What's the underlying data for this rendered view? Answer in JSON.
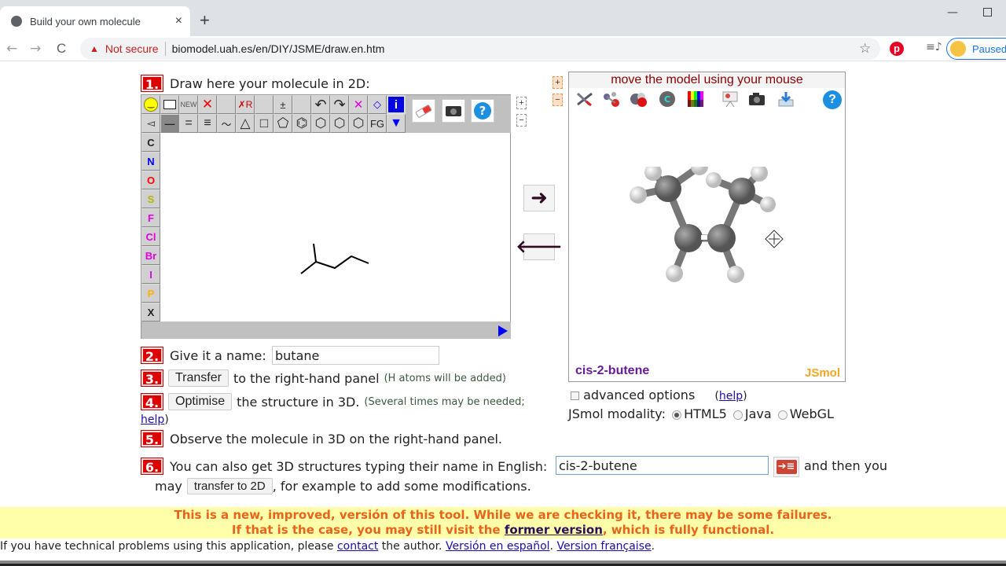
{
  "browser": {
    "tab_title": "Build your own molecule",
    "tab_close": "×",
    "new_tab": "+",
    "back": "←",
    "forward": "→",
    "reload": "C",
    "security_warning": "Not secure",
    "url": "biomodel.uah.es/en/DIY/JSME/draw.en.htm",
    "star": "☆",
    "pinterest": "p",
    "media": "≡♪",
    "profile_label": "Paused",
    "minimize": "—"
  },
  "steps": {
    "s1": {
      "num": "1.",
      "text": "Draw here your molecule in 2D:"
    },
    "s2": {
      "num": "2.",
      "text": "Give it a name:",
      "name_value": "butane"
    },
    "s3": {
      "num": "3.",
      "button": "Transfer",
      "text": "to the right-hand panel",
      "note": "(H atoms will be added)"
    },
    "s4": {
      "num": "4.",
      "button": "Optimise",
      "text": "the structure in 3D.",
      "note": "(Several times may be needed;",
      "help": "help",
      "close": ")"
    },
    "s5": {
      "num": "5.",
      "text": "Observe the molecule in 3D on the right-hand panel."
    },
    "s6": {
      "num": "6.",
      "text": "You can also get 3D structures typing their name in English:",
      "name_value": "cis-2-butene",
      "after": "and then you",
      "may": "may",
      "button": "transfer to 2D",
      "rest": ", for example to add some modifications."
    }
  },
  "jsme": {
    "row1": [
      "☺",
      "□",
      "NEW",
      "✕",
      "",
      "✗R",
      "",
      "±",
      "",
      "↶",
      "↷",
      "✕",
      "◇",
      "i"
    ],
    "row2": [
      "◅",
      "—",
      "=",
      "≡",
      "〜",
      "△",
      "□",
      "⬠",
      "⌬",
      "⬡",
      "⬡",
      "⬡",
      "FG",
      "▼"
    ],
    "atoms": [
      {
        "label": "C",
        "color": "#222222"
      },
      {
        "label": "N",
        "color": "#0000ff"
      },
      {
        "label": "O",
        "color": "#ff0000"
      },
      {
        "label": "S",
        "color": "#b5b500"
      },
      {
        "label": "F",
        "color": "#e000e0"
      },
      {
        "label": "Cl",
        "color": "#e000e0"
      },
      {
        "label": "Br",
        "color": "#e000e0"
      },
      {
        "label": "I",
        "color": "#e000e0"
      },
      {
        "label": "P",
        "color": "#ffb000"
      },
      {
        "label": "X",
        "color": "#222222"
      }
    ],
    "eraser": "eraser",
    "camera": "camera",
    "help": "?"
  },
  "zoom": {
    "plus": "+",
    "minus": "−"
  },
  "arrows": {
    "right": "➜",
    "left": "🡐"
  },
  "jsmol": {
    "header": "move the model using your mouse",
    "molecule_name": "cis-2-butene",
    "brand": "JSmol",
    "help": "?"
  },
  "options": {
    "advanced": "advanced options",
    "help_open": "(",
    "help": "help",
    "help_close": ")",
    "modality_label": "JSmol modality:",
    "modalities": [
      "HTML5",
      "Java",
      "WebGL"
    ],
    "selected_modality": "HTML5"
  },
  "banner": {
    "line1": "This is a new, improved, versión of this tool. While we are checking it, there may be some failures.",
    "line2_pre": "If that is the case, you may still visit the",
    "line2_link": "former version",
    "line2_post": ", which is fully functional."
  },
  "footer": {
    "pre": "If you have technical problems using this application, please",
    "contact": "contact",
    "mid": "the author.",
    "es": "Versión en español",
    "dot": ".",
    "fr": "Version française",
    "end": "."
  },
  "colors": {
    "step_badge": "#dd0000",
    "banner_bg": "#ffffaa",
    "banner_text": "#e8631c",
    "link": "#1a0dab",
    "molecule_name": "#6a1b9a",
    "jsmol_brand": "#f5a623"
  }
}
